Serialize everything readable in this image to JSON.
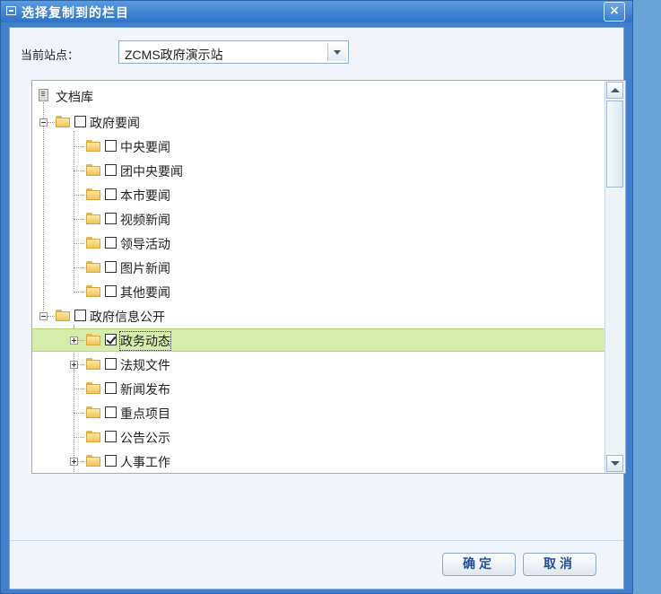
{
  "dialog": {
    "title": "选择复制到的栏目",
    "close_label": "×"
  },
  "site": {
    "label": "当前站点：",
    "selected": "ZCMS政府演示站"
  },
  "tree": {
    "root": "文档库",
    "nodes": [
      {
        "label": "政府要闻",
        "checked": false
      },
      {
        "label": "中央要闻",
        "checked": false
      },
      {
        "label": "团中央要闻",
        "checked": false
      },
      {
        "label": "本市要闻",
        "checked": false
      },
      {
        "label": "视频新闻",
        "checked": false
      },
      {
        "label": "领导活动",
        "checked": false
      },
      {
        "label": "图片新闻",
        "checked": false
      },
      {
        "label": "其他要闻",
        "checked": false
      },
      {
        "label": "政府信息公开",
        "checked": false
      },
      {
        "label": "政务动态",
        "checked": true
      },
      {
        "label": "法规文件",
        "checked": false
      },
      {
        "label": "新闻发布",
        "checked": false
      },
      {
        "label": "重点项目",
        "checked": false
      },
      {
        "label": "公告公示",
        "checked": false
      },
      {
        "label": "人事工作",
        "checked": false
      }
    ]
  },
  "buttons": {
    "ok": "确定",
    "cancel": "取消"
  }
}
